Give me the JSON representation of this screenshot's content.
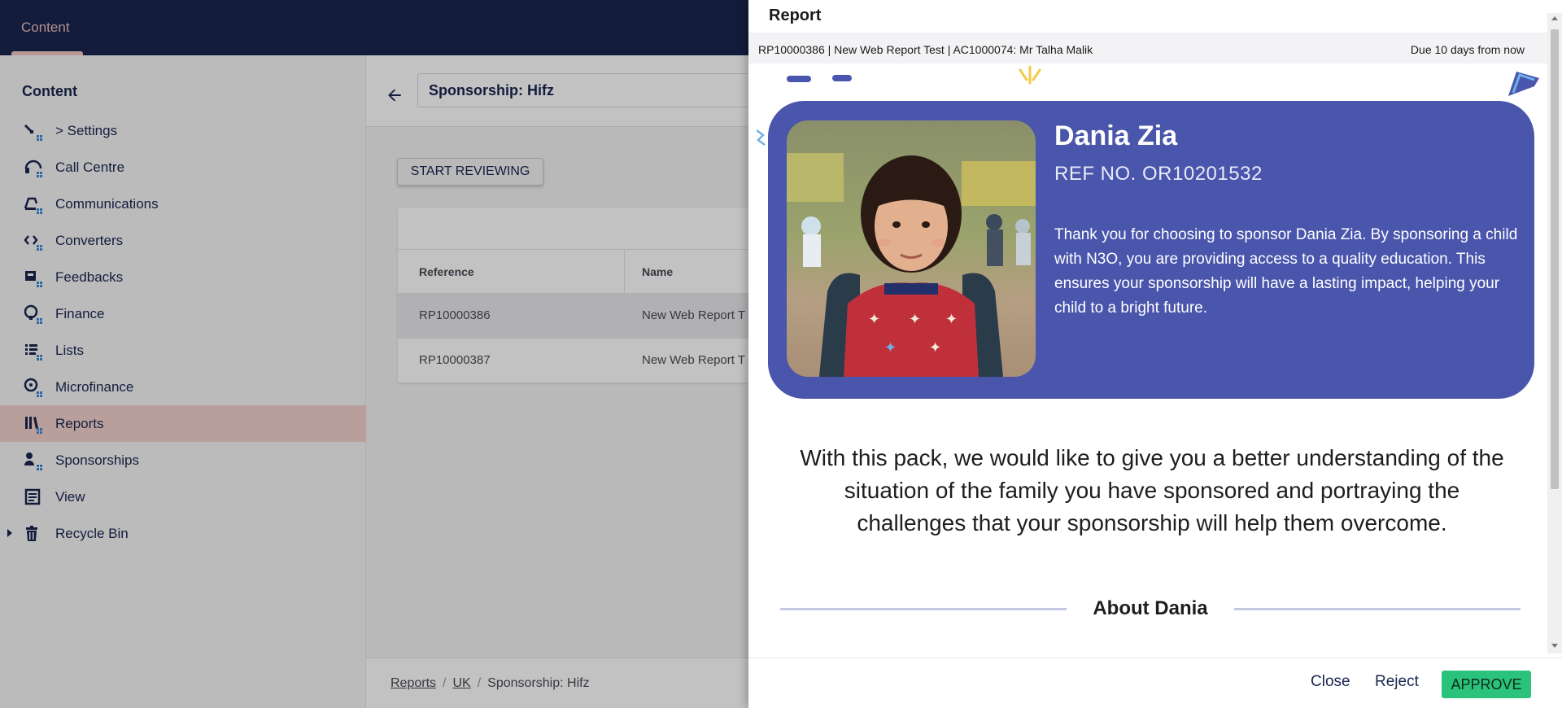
{
  "topbar": {
    "section": "Content"
  },
  "sidebar": {
    "title": "Content",
    "items": [
      {
        "label": "> Settings",
        "icon": "wrench-icon"
      },
      {
        "label": "Call Centre",
        "icon": "headset-icon"
      },
      {
        "label": "Communications",
        "icon": "communications-icon"
      },
      {
        "label": "Converters",
        "icon": "converter-icon"
      },
      {
        "label": "Feedbacks",
        "icon": "feedback-icon"
      },
      {
        "label": "Finance",
        "icon": "finance-icon"
      },
      {
        "label": "Lists",
        "icon": "list-icon"
      },
      {
        "label": "Microfinance",
        "icon": "microfinance-icon"
      },
      {
        "label": "Reports",
        "icon": "reports-icon",
        "active": true
      },
      {
        "label": "Sponsorships",
        "icon": "sponsorship-icon"
      },
      {
        "label": "View",
        "icon": "view-icon"
      },
      {
        "label": "Recycle Bin",
        "icon": "trash-icon"
      }
    ]
  },
  "main": {
    "name_value": "Sponsorship: Hifz",
    "start_reviewing": "START REVIEWING",
    "table": {
      "headers": [
        "Reference",
        "Name"
      ],
      "rows": [
        {
          "reference": "RP10000386",
          "name": "New Web Report T"
        },
        {
          "reference": "RP10000387",
          "name": "New Web Report T"
        }
      ]
    },
    "breadcrumb": [
      "Reports",
      "UK",
      "Sponsorship: Hifz"
    ]
  },
  "dialog": {
    "title": "Report",
    "subtitle": "RP10000386 | New Web Report Test | AC1000074: Mr Talha Malik",
    "due": "Due 10 days from now",
    "hero": {
      "name": "Dania Zia",
      "ref": "REF NO. OR10201532",
      "text": "Thank you for choosing to sponsor Dania Zia. By sponsoring a child with N3O, you are providing access to a quality education. This ensures your sponsorship will have a lasting impact, helping your child to a bright future."
    },
    "intro": "With this pack, we would like to give you a better understanding of the situation of the family you have sponsored and portraying the challenges that your sponsorship will help them overcome.",
    "about_title": "About Dania",
    "close": "Close",
    "reject": "Reject",
    "approve": "APPROVE"
  },
  "colors": {
    "topbar": "#1b264f",
    "hero": "#4a55ac",
    "approve": "#2bc37c",
    "active_item": "#f3d2ce"
  }
}
